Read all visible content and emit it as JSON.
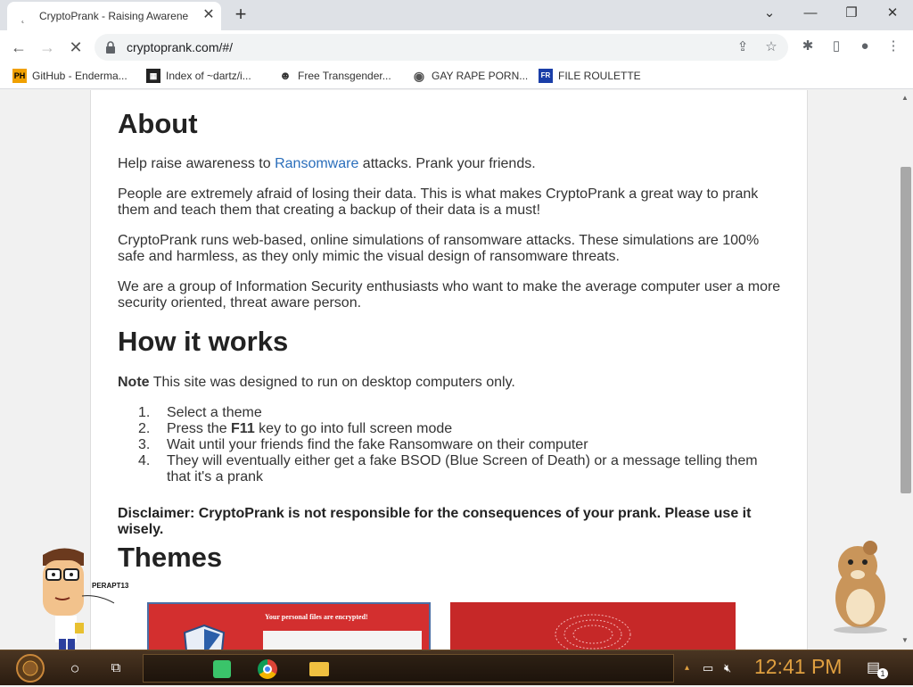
{
  "browser": {
    "tab_title": "CryptoPrank - Raising Awarene",
    "url": "cryptoprank.com/#/",
    "bookmarks": [
      {
        "label": "GitHub - Enderma...",
        "icon": "PH"
      },
      {
        "label": "Index of ~dartz/i...",
        "icon": "grid"
      },
      {
        "label": "Free Transgender...",
        "icon": "mask"
      },
      {
        "label": "GAY RAPE PORN...",
        "icon": "globe"
      },
      {
        "label": "FILE ROULETTE",
        "icon": "tag"
      }
    ]
  },
  "page": {
    "about_title": "About",
    "about_p1_pre": "Help raise awareness to ",
    "about_p1_link": "Ransomware",
    "about_p1_post": " attacks. Prank your friends.",
    "about_p2": "People are extremely afraid of losing their data. This is what makes CryptoPrank a great way to prank them and teach them that creating a backup of their data is a must!",
    "about_p3": "CryptoPrank runs web-based, online simulations of ransomware attacks. These simulations are 100% safe and harmless, as they only mimic the visual design of ransomware threats.",
    "about_p4": "We are a group of Information Security enthusiasts who want to make the average computer user a more security oriented, threat aware person.",
    "how_title": "How it works",
    "note_label": "Note",
    "note_text": " This site was designed to run on desktop computers only.",
    "steps": [
      {
        "num": "1.",
        "pre": "Select a theme",
        "bold": "",
        "post": ""
      },
      {
        "num": "2.",
        "pre": "Press the ",
        "bold": "F11",
        "post": " key to go into full screen mode"
      },
      {
        "num": "3.",
        "pre": "Wait until your friends find the fake Ransomware on their computer",
        "bold": "",
        "post": ""
      },
      {
        "num": "4.",
        "pre": "They will eventually either get a fake BSOD (Blue Screen of Death) or a message telling them that it's a prank",
        "bold": "",
        "post": ""
      }
    ],
    "disclaimer": "Disclaimer: CryptoPrank is not responsible for the consequences of your prank. Please use it wisely.",
    "themes_title": "Themes",
    "theme1_caption": "Your personal files are encrypted!"
  },
  "taskbar": {
    "clock": "12:41 PM",
    "notification_count": "1"
  },
  "desktop": {
    "speech_text": "PERAPT13"
  }
}
